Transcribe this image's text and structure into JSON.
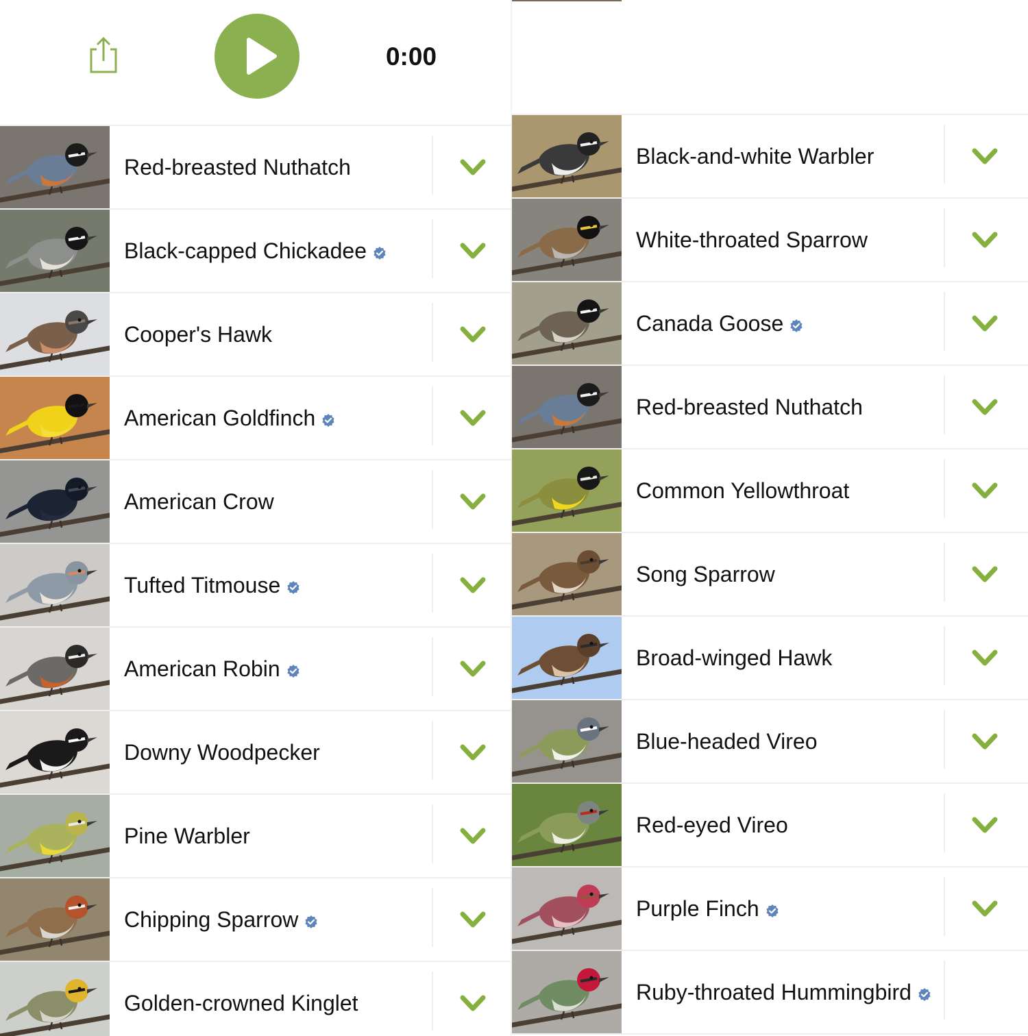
{
  "player": {
    "timer": "0:00",
    "accent_color": "#8ab04f",
    "share_icon": "share-icon",
    "play_icon": "play-icon"
  },
  "left_list": [
    {
      "name": "Red-breasted Nuthatch",
      "verified": false,
      "photo": {
        "bg": "#6f6a63",
        "body": "#6a7d97",
        "belly": "#c9783d",
        "head": "#1b1b1b",
        "accent": "#f2f2f2"
      }
    },
    {
      "name": "Black-capped Chickadee",
      "verified": true,
      "photo": {
        "bg": "#6a6f60",
        "body": "#8d8f8c",
        "belly": "#e6e1d6",
        "head": "#151515",
        "accent": "#f5f5f5"
      }
    },
    {
      "name": "Cooper's Hawk",
      "verified": false,
      "photo": {
        "bg": "#d9dcdf",
        "body": "#7a5f4a",
        "belly": "#c98e6a",
        "head": "#4a4846",
        "accent": "#8b7a6a"
      }
    },
    {
      "name": "American Goldfinch",
      "verified": true,
      "photo": {
        "bg": "#c27b3e",
        "body": "#f0d21b",
        "belly": "#f4dd3a",
        "head": "#111111",
        "accent": "#1a1a1a"
      }
    },
    {
      "name": "American Crow",
      "verified": false,
      "photo": {
        "bg": "#8c8e8a",
        "body": "#1c2333",
        "belly": "#222a3b",
        "head": "#141a26",
        "accent": "#3f4a5e"
      }
    },
    {
      "name": "Tufted Titmouse",
      "verified": true,
      "photo": {
        "bg": "#c9c6c3",
        "body": "#8e9aa6",
        "belly": "#e9e3dc",
        "head": "#8894a0",
        "accent": "#d9895c"
      }
    },
    {
      "name": "American Robin",
      "verified": true,
      "photo": {
        "bg": "#d5d3cf",
        "body": "#6b6a67",
        "belly": "#c8622a",
        "head": "#2b2a28",
        "accent": "#f0f0f0"
      }
    },
    {
      "name": "Downy Woodpecker",
      "verified": false,
      "photo": {
        "bg": "#d9d6d1",
        "body": "#1a1a1a",
        "belly": "#f1f1ef",
        "head": "#1a1a1a",
        "accent": "#ffffff"
      }
    },
    {
      "name": "Pine Warbler",
      "verified": false,
      "photo": {
        "bg": "#9fa79b",
        "body": "#aab25e",
        "belly": "#e8d83a",
        "head": "#b9b54a",
        "accent": "#e9e9e9"
      }
    },
    {
      "name": "Chipping Sparrow",
      "verified": true,
      "photo": {
        "bg": "#8a7c62",
        "body": "#8f6f4b",
        "belly": "#d8d6cf",
        "head": "#b4532c",
        "accent": "#f2f2ee"
      }
    },
    {
      "name": "Golden-crowned Kinglet",
      "verified": false,
      "photo": {
        "bg": "#c8cbc6",
        "body": "#8a8f6a",
        "belly": "#d4d4c8",
        "head": "#e0b52d",
        "accent": "#1a1a1a"
      }
    }
  ],
  "right_list": [
    {
      "name": "Black-and-white Warbler",
      "verified": false,
      "chevron": true,
      "photo": {
        "bg": "#a48f63",
        "body": "#3a3a3a",
        "belly": "#eeeeee",
        "head": "#222222",
        "accent": "#f2f2f2"
      }
    },
    {
      "name": "White-throated Sparrow",
      "verified": false,
      "chevron": true,
      "photo": {
        "bg": "#7d7a73",
        "body": "#8a6b49",
        "belly": "#b9b7b3",
        "head": "#111111",
        "accent": "#e9c434"
      }
    },
    {
      "name": "Canada Goose",
      "verified": true,
      "chevron": true,
      "photo": {
        "bg": "#9b9784",
        "body": "#6e6255",
        "belly": "#d7d1c8",
        "head": "#141414",
        "accent": "#f5f5f5"
      }
    },
    {
      "name": "Red-breasted Nuthatch",
      "verified": false,
      "chevron": true,
      "photo": {
        "bg": "#6f6a63",
        "body": "#6a7d97",
        "belly": "#c9783d",
        "head": "#1b1b1b",
        "accent": "#f2f2f2"
      }
    },
    {
      "name": "Common Yellowthroat",
      "verified": false,
      "chevron": true,
      "photo": {
        "bg": "#8b9a4e",
        "body": "#8b8d3f",
        "belly": "#f2d71e",
        "head": "#181818",
        "accent": "#e8e8e0"
      }
    },
    {
      "name": "Song Sparrow",
      "verified": false,
      "chevron": true,
      "photo": {
        "bg": "#a19072",
        "body": "#7a5a3c",
        "belly": "#e0d7c8",
        "head": "#6b4e34",
        "accent": "#4a3a2a"
      }
    },
    {
      "name": "Broad-winged Hawk",
      "verified": false,
      "chevron": true,
      "photo": {
        "bg": "#a9c7ef",
        "body": "#6e4f36",
        "belly": "#d9c2a6",
        "head": "#5b3f2a",
        "accent": "#2a2a2a"
      }
    },
    {
      "name": "Blue-headed Vireo",
      "verified": false,
      "chevron": true,
      "photo": {
        "bg": "#8e8a86",
        "body": "#8c9b5c",
        "belly": "#f3f2ea",
        "head": "#6a7380",
        "accent": "#ffffff"
      }
    },
    {
      "name": "Red-eyed Vireo",
      "verified": false,
      "chevron": true,
      "photo": {
        "bg": "#5e7c2e",
        "body": "#8a9b5a",
        "belly": "#eeeee4",
        "head": "#7e8580",
        "accent": "#b82c1e"
      }
    },
    {
      "name": "Purple Finch",
      "verified": true,
      "chevron": true,
      "photo": {
        "bg": "#b8b4b0",
        "body": "#a2505e",
        "belly": "#e4bfc4",
        "head": "#c03b55",
        "accent": "#8c5a3e"
      }
    },
    {
      "name": "Ruby-throated Hummingbird",
      "verified": true,
      "chevron": false,
      "photo": {
        "bg": "#a8a4a0",
        "body": "#6f8c64",
        "belly": "#d9ddd3",
        "head": "#c4183a",
        "accent": "#2a2a2a"
      }
    }
  ],
  "colors": {
    "chevron": "#86b03e",
    "verified_badge": "#5d84bb"
  }
}
